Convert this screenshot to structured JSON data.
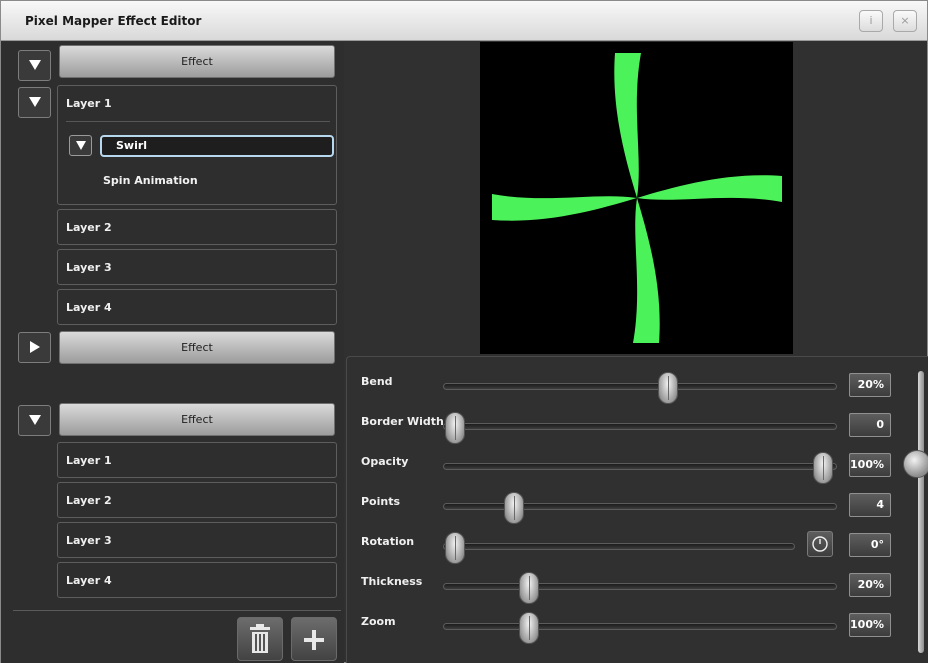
{
  "window": {
    "title": "Pixel Mapper Effect Editor",
    "info_button": "i",
    "close_button": "×"
  },
  "left_panel": {
    "groups": [
      {
        "effect_label": "Effect",
        "expanded": true,
        "layers": [
          {
            "label": "Layer 1",
            "expanded": true,
            "effect_type": "Swirl",
            "animation": "Spin Animation"
          },
          {
            "label": "Layer 2"
          },
          {
            "label": "Layer 3"
          },
          {
            "label": "Layer 4"
          }
        ]
      },
      {
        "effect_label": "Effect",
        "expanded": false
      },
      {
        "effect_label": "Effect",
        "expanded": true,
        "layers": [
          {
            "label": "Layer 1"
          },
          {
            "label": "Layer 2"
          },
          {
            "label": "Layer 3"
          },
          {
            "label": "Layer 4"
          }
        ]
      }
    ],
    "toolbar": {
      "delete_icon": "trash-icon",
      "add_icon": "plus-icon"
    }
  },
  "preview": {
    "shape": "swirl",
    "points": 4,
    "color": "#4cf25a",
    "background": "#000000"
  },
  "properties": [
    {
      "name": "Bend",
      "value": "20%",
      "level": 0.58
    },
    {
      "name": "Border Width",
      "value": "0",
      "level": 0.0
    },
    {
      "name": "Opacity",
      "value": "100%",
      "level": 1.0
    },
    {
      "name": "Points",
      "value": "4",
      "level": 0.16
    },
    {
      "name": "Rotation",
      "value": "0°",
      "level": 0.0,
      "has_clock": true
    },
    {
      "name": "Thickness",
      "value": "20%",
      "level": 0.2
    },
    {
      "name": "Zoom",
      "value": "100%",
      "level": 0.2
    }
  ],
  "colors": {
    "accent_input_border": "#b7d7ee",
    "swirl_green": "#4cf25a"
  }
}
